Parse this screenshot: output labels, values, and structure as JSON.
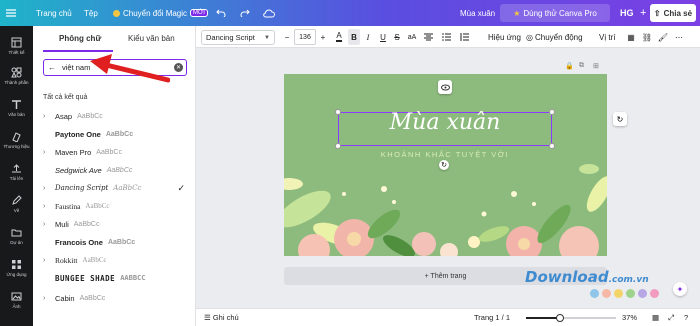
{
  "topbar": {
    "home": "Trang chủ",
    "file": "Tệp",
    "magic": "Chuyển đổi Magic",
    "magic_badge": "MỚI",
    "doc_title": "Mùa xuân",
    "try_pro": "Dùng thử Canva Pro",
    "avatar": "HG",
    "share": "Chia sẻ"
  },
  "rail": [
    {
      "label": "Thiết kế",
      "icon": "layout-icon"
    },
    {
      "label": "Thành phần",
      "icon": "elements-icon"
    },
    {
      "label": "Văn bản",
      "icon": "text-icon"
    },
    {
      "label": "Thương hiệu",
      "icon": "brand-icon"
    },
    {
      "label": "Tải lên",
      "icon": "upload-icon"
    },
    {
      "label": "Vẽ",
      "icon": "draw-icon"
    },
    {
      "label": "Dự án",
      "icon": "folder-icon"
    },
    {
      "label": "Ứng dụng",
      "icon": "apps-icon"
    },
    {
      "label": "Ảnh",
      "icon": "photo-icon"
    }
  ],
  "panel": {
    "tab_fonts": "Phông chữ",
    "tab_styles": "Kiểu văn bản",
    "search_value": "việt nam",
    "section_title": "Tất cả kết quả",
    "fonts": [
      {
        "name": "Asap",
        "sample": "AaBbCc",
        "checked": false
      },
      {
        "name": "Paytone One",
        "sample": "AaBbCc",
        "checked": false
      },
      {
        "name": "Maven Pro",
        "sample": "AaBbCc",
        "checked": false
      },
      {
        "name": "Sedgwick Ave",
        "sample": "AaBbCc",
        "checked": false
      },
      {
        "name": "Dancing Script",
        "sample": "AaBbCc",
        "checked": true
      },
      {
        "name": "Faustina",
        "sample": "AaBbCc",
        "checked": false
      },
      {
        "name": "Muli",
        "sample": "AaBbCc",
        "checked": false
      },
      {
        "name": "Francois One",
        "sample": "AaBbCc",
        "checked": false
      },
      {
        "name": "Rokkitt",
        "sample": "AaBbCc",
        "checked": false
      },
      {
        "name": "BUNGEE SHADE",
        "sample": "AABBCC",
        "checked": false
      },
      {
        "name": "Cabin",
        "sample": "AaBbCc",
        "checked": false
      }
    ]
  },
  "toolbar": {
    "font": "Dancing Script",
    "size": "136",
    "bold": "B",
    "italic": "I",
    "underline": "U",
    "strike": "S",
    "case": "aA",
    "effects": "Hiệu ứng",
    "animate": "Chuyển động",
    "position": "Vị trí"
  },
  "design": {
    "title": "Mùa xuân",
    "subtitle": "KHOẢNH KHẮC TUYỆT VỜI",
    "add_page": "+ Thêm trang"
  },
  "status": {
    "notes": "Ghi chú",
    "page": "Trang 1 / 1",
    "zoom": "37%",
    "zoom_fraction": 0.37
  },
  "watermark": {
    "text": "Download",
    "suffix": ".com.vn"
  },
  "colors": {
    "accent": "#7d2ae8",
    "background": "#8dbb7e",
    "arrow": "#e02020"
  }
}
